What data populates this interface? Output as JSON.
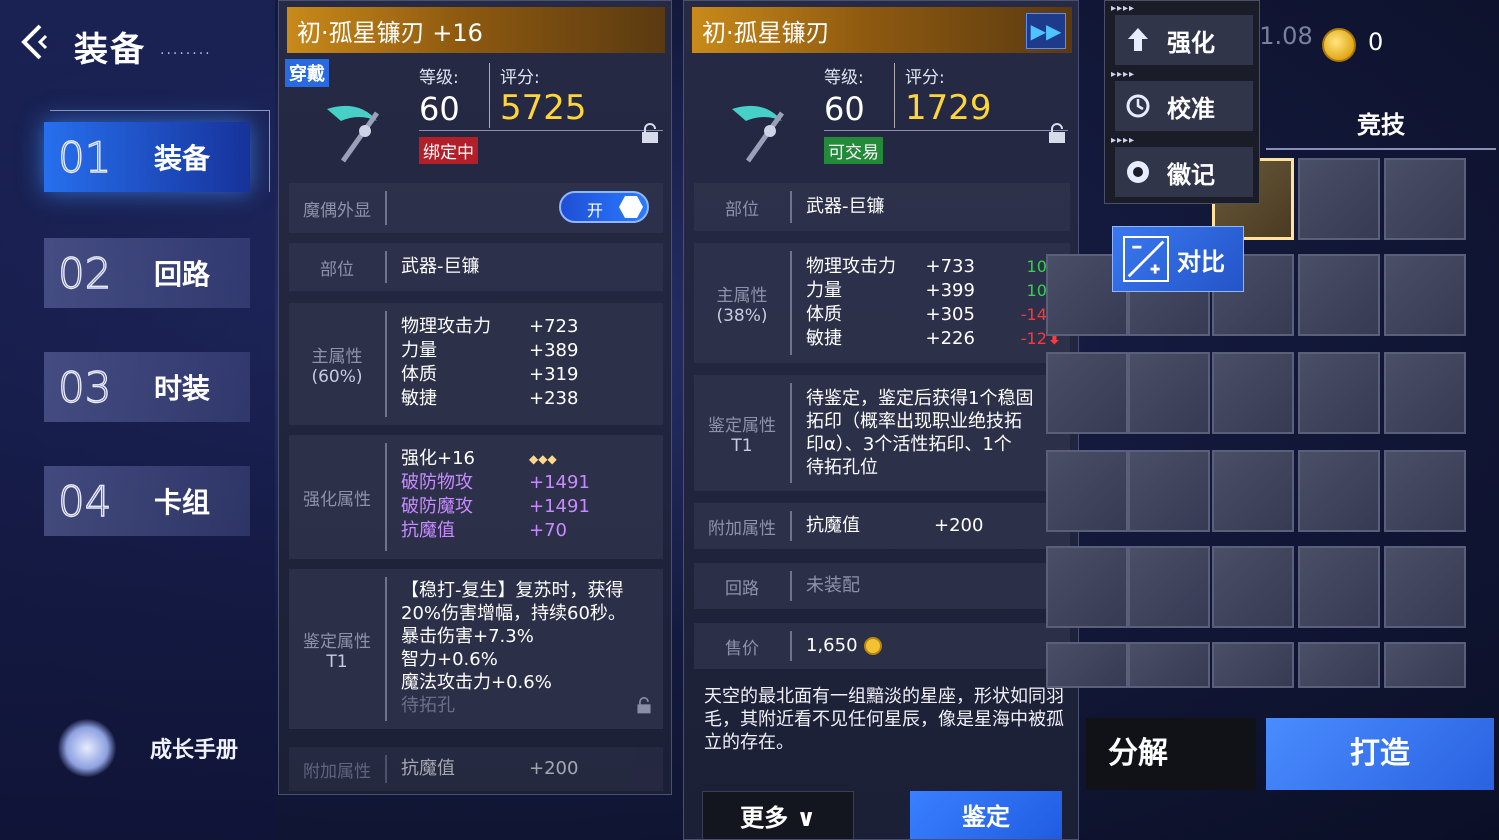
{
  "nav": {
    "title": "装备",
    "title_dots": "........",
    "items": [
      {
        "num": "01",
        "label": "装备"
      },
      {
        "num": "02",
        "label": "回路"
      },
      {
        "num": "03",
        "label": "时装"
      },
      {
        "num": "04",
        "label": "卡组"
      }
    ],
    "growth_label": "成长手册"
  },
  "equipped": {
    "name": "初·孤星镰刃 +16",
    "wear_badge": "穿戴",
    "level_label": "等级:",
    "score_label": "评分:",
    "level": "60",
    "score": "5725",
    "bind_tag": "绑定中",
    "rows": {
      "appearance_label": "魔偶外显",
      "toggle_label": "开",
      "slot_label": "部位",
      "slot_value": "武器-巨镰",
      "main_label": "主属性",
      "main_pct": "(60%)",
      "main_attrs": [
        {
          "name": "物理攻击力",
          "value": "+723"
        },
        {
          "name": "力量",
          "value": "+389"
        },
        {
          "name": "体质",
          "value": "+319"
        },
        {
          "name": "敏捷",
          "value": "+238"
        }
      ],
      "enhance_label": "强化属性",
      "enhance_attrs": [
        {
          "name": "强化+16",
          "value": "◆◆◆"
        },
        {
          "name": "破防物攻",
          "value": "+1491"
        },
        {
          "name": "破防魔攻",
          "value": "+1491"
        },
        {
          "name": "抗魔值",
          "value": "+70"
        }
      ],
      "identify_label": "鉴定属性",
      "identify_tier": "T1",
      "identify_lines": [
        "【稳打-复生】复苏时，获得",
        "20%伤害增幅，持续60秒。",
        "暴击伤害+7.3%",
        "智力+0.6%",
        "魔法攻击力+0.6%",
        "待拓孔"
      ],
      "extra_label": "附加属性",
      "extra_name": "抗魔值",
      "extra_value": "+200"
    }
  },
  "compare": {
    "name": "初·孤星镰刃",
    "ff_icon": "fast-forward-icon",
    "level_label": "等级:",
    "score_label": "评分:",
    "level": "60",
    "score": "1729",
    "trade_tag": "可交易",
    "slot_label": "部位",
    "slot_value": "武器-巨镰",
    "main_label": "主属性",
    "main_pct": "(38%)",
    "main_attrs": [
      {
        "name": "物理攻击力",
        "value": "+733",
        "delta": "10",
        "dir": "up"
      },
      {
        "name": "力量",
        "value": "+399",
        "delta": "10",
        "dir": "up"
      },
      {
        "name": "体质",
        "value": "+305",
        "delta": "-14",
        "dir": "down"
      },
      {
        "name": "敏捷",
        "value": "+226",
        "delta": "-12",
        "dir": "down"
      }
    ],
    "identify_label": "鉴定属性",
    "identify_tier": "T1",
    "identify_lines": [
      "待鉴定，鉴定后获得1个稳固",
      "拓印（概率出现职业绝技拓",
      "印α）、3个活性拓印、1个",
      "待拓孔位"
    ],
    "extra_label": "附加属性",
    "extra_name": "抗魔值",
    "extra_value": "+200",
    "circuit_label": "回路",
    "circuit_value": "未装配",
    "price_label": "售价",
    "price_value": "1,650",
    "description": "天空的最北面有一组黯淡的星座，形状如同羽毛，其附近看不见任何星辰，像是星海中被孤立的存在。",
    "more_label": "更多 ∨",
    "identify_btn": "鉴定"
  },
  "right": {
    "currency1": "11.08",
    "currency2": "0",
    "arena_tab": "竞技",
    "menu": [
      {
        "label": "强化",
        "icon": "enhance-icon"
      },
      {
        "label": "校准",
        "icon": "calibrate-icon"
      },
      {
        "label": "徽记",
        "icon": "emblem-icon"
      }
    ],
    "compare_label": "对比",
    "dismantle_label": "分解",
    "forge_label": "打造"
  },
  "colors": {
    "accent_blue": "#2a6ae0",
    "score_yellow": "#ffd63a",
    "header_gold": "#c98a1a",
    "bind_red": "#b21f28",
    "trade_green": "#238a3a",
    "up_green": "#34d34e",
    "down_red": "#ff3838",
    "purple_text": "#c78bff"
  }
}
